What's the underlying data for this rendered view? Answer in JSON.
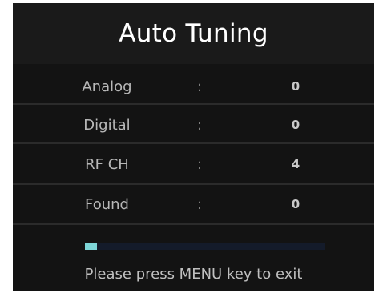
{
  "title": "Auto Tuning",
  "rows": [
    {
      "label": "Analog",
      "separator": ":",
      "value": "0"
    },
    {
      "label": "Digital",
      "separator": ":",
      "value": "0"
    },
    {
      "label": "RF CH",
      "separator": ":",
      "value": "4"
    },
    {
      "label": "Found",
      "separator": ":",
      "value": "0"
    }
  ],
  "progress": {
    "fraction": 0.05,
    "fill_color": "#7ed6d8"
  },
  "hint": "Please press MENU key to exit",
  "colors": {
    "panel": "#131313",
    "title_bar": "#1a1a1a",
    "text": "#b8b8b8"
  }
}
